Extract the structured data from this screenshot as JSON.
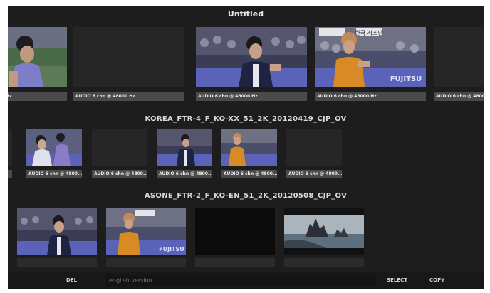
{
  "window": {
    "title": "Untitled"
  },
  "strips": [
    {
      "name": "",
      "clips": [
        {
          "label": "Hz"
        },
        {
          "label": "AUDIO 6 chn @ 48000 Hz"
        },
        {
          "label": "AUDIO 6 chn @ 48000 Hz"
        },
        {
          "label": "AUDIO 6 chn @ 48000 Hz"
        },
        {
          "label": "AUDIO 6 chn @ 48000 Hz"
        }
      ]
    },
    {
      "name": "KOREA_FTR-4_F_KO-XX_51_2K_20120419_CJP_OV",
      "clips": [
        {
          "label": "AUDIO 6 chn @ 4800..."
        },
        {
          "label": "AUDIO 6 chn @ 4800..."
        },
        {
          "label": "AUDIO 6 chn @ 4800..."
        },
        {
          "label": "AUDIO 6 chn @ 4800..."
        },
        {
          "label": "AUDIO 6 chn @ 4800..."
        }
      ]
    },
    {
      "name": "ASONE_FTR-2_F_KO-EN_51_2K_20120508_CJP_OV",
      "clips": [
        {},
        {},
        {},
        {}
      ]
    }
  ],
  "thumb_text": {
    "banner": "한국 시스단",
    "sponsor": "FUJITSU"
  },
  "bottom_bar": {
    "del_label": "DEL",
    "version_placeholder": "english version",
    "select_label": "SELECT",
    "copy_label": "COPY"
  },
  "colors": {
    "background": "#1d1d1d",
    "label_bg": "#4a4a4a",
    "court_blue": "#5a63b8",
    "jersey_orange": "#d88a25"
  }
}
